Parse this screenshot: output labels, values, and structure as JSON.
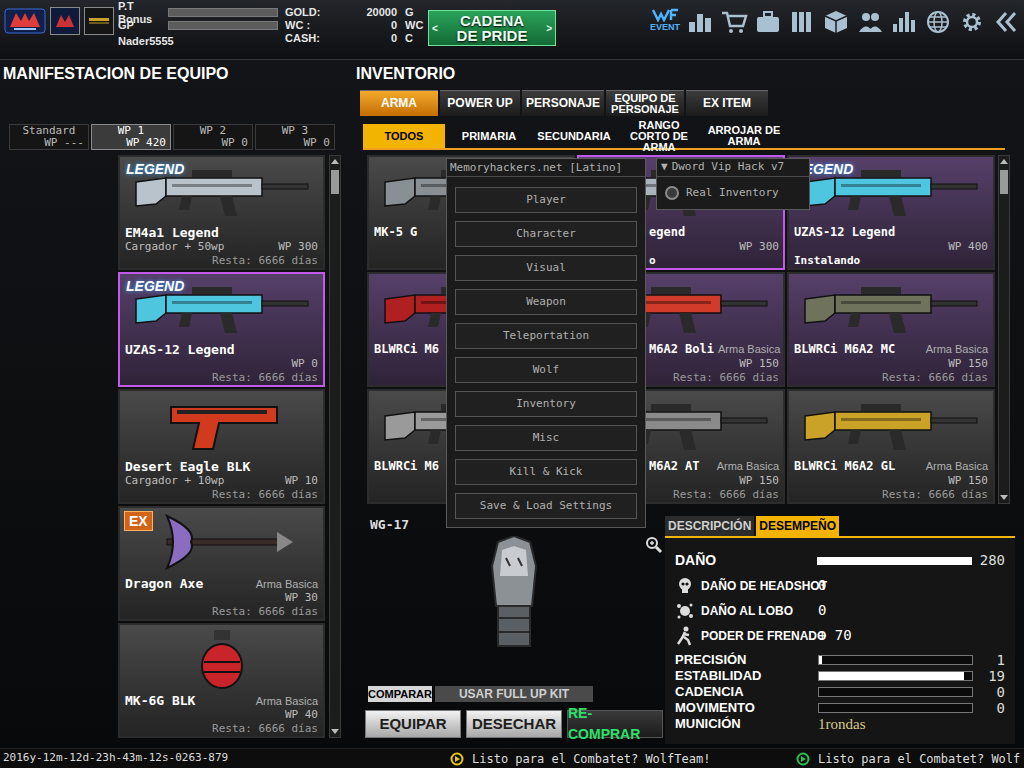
{
  "top_bar": {
    "pt_bonus": {
      "label": "P.T Bonus",
      "level": 0
    },
    "gp": {
      "label": "GP",
      "level": 0
    },
    "username": "Nader5555",
    "currencies": [
      {
        "label": "GOLD:",
        "value": "20000",
        "unit": "G"
      },
      {
        "label": "WC :",
        "value": "0",
        "unit": "WC"
      },
      {
        "label": "CASH:",
        "value": "0",
        "unit": "C"
      }
    ],
    "event_button": {
      "prev": "<",
      "line1": "CADENA",
      "line2": "DE PRIDE",
      "next": ">"
    },
    "event_label": "EVENT"
  },
  "equipment": {
    "title": "MANIFESTACION DE EQUIPO",
    "slots": [
      {
        "label": "Standard",
        "wp": "WP ---",
        "selected": false
      },
      {
        "label": "WP 1",
        "wp": "WP 420",
        "selected": true
      },
      {
        "label": "WP 2",
        "wp": "WP 0",
        "selected": false
      },
      {
        "label": "WP 3",
        "wp": "WP 0",
        "selected": false
      }
    ],
    "cards": [
      {
        "name": "EM4a1 Legend",
        "note": "Cargador + 50wp",
        "wp": "WP 300",
        "resta": "Resta: 6666 días",
        "badge": {
          "text": "LEGEND",
          "kind": "legend"
        },
        "kind": "rifle",
        "color": "#b9c3cc",
        "highlighted": false,
        "selected": false
      },
      {
        "name": "UZAS-12 Legend",
        "wp": "WP 0",
        "resta": "Resta: 6666 días",
        "badge": {
          "text": "LEGEND",
          "kind": "legend"
        },
        "kind": "rifle",
        "color": "#4fc6e0",
        "highlighted": true,
        "selected": true
      },
      {
        "name": "Desert Eagle BLK",
        "note": "Cargador + 10wp",
        "wp": "WP 10",
        "resta": "Resta: 6666 días",
        "kind": "pistol",
        "color": "#d23a1e",
        "highlighted": false,
        "selected": false
      },
      {
        "name": "Dragon Axe",
        "type": "Arma Basica",
        "wp": "WP 30",
        "resta": "Resta: 6666 días",
        "badge": {
          "text": "EX",
          "kind": "tag"
        },
        "kind": "axe",
        "color": "#8a6cc0",
        "highlighted": false,
        "selected": false
      },
      {
        "name": "MK-6G BLK",
        "type": "Arma Basica",
        "wp": "WP 40",
        "resta": "Resta: 6666 días",
        "kind": "grenade",
        "color": "#c8242a",
        "highlighted": false,
        "selected": false
      }
    ]
  },
  "inventory": {
    "title": "INVENTORIO",
    "tabs": [
      {
        "label": "ARMA",
        "selected": true
      },
      {
        "label": "POWER UP",
        "selected": false
      },
      {
        "label": "PERSONAJE",
        "selected": false
      },
      {
        "label": "EQUIPO DE PERSONAJE",
        "selected": false
      },
      {
        "label": "EX ITEM",
        "selected": false
      }
    ],
    "subtabs": [
      {
        "label": "TODOS",
        "selected": true
      },
      {
        "label": "PRIMARIA",
        "selected": false
      },
      {
        "label": "SECUNDARIA",
        "selected": false
      },
      {
        "label": "RANGO CORTO DE ARMA",
        "selected": false
      },
      {
        "label": "ARROJAR DE ARMA",
        "selected": false
      }
    ],
    "items": [
      {
        "name": "MK-5 G",
        "kind": "rifle",
        "color": "#8a8f94",
        "highlighted": false,
        "selected": false
      },
      {
        "name": "egend",
        "wp": "WP 300",
        "status": "o",
        "kind": "rifle",
        "color": "#aab4bd",
        "highlighted": true,
        "selected": true
      },
      {
        "name": "UZAS-12 Legend",
        "wp": "WP 400",
        "status": "Instalando",
        "badge": {
          "text": "LEGEND",
          "kind": "legend"
        },
        "kind": "rifle",
        "color": "#4fc6e0",
        "highlighted": true,
        "selected": false
      },
      {
        "name": "BLWRCi M6",
        "kind": "rifle",
        "color": "#b02020",
        "highlighted": true,
        "selected": false
      },
      {
        "name": "M6A2 Boli",
        "type": "Arma Basica",
        "wp": "WP 150",
        "resta": "Resta: 6666 días",
        "kind": "rifle",
        "color": "#d23a2a",
        "highlighted": true,
        "selected": false
      },
      {
        "name": "BLWRCi M6A2 MC",
        "type": "Arma Basica",
        "wp": "WP 150",
        "resta": "Resta: 6666 días",
        "kind": "rifle",
        "color": "#6f735c",
        "highlighted": true,
        "selected": false
      },
      {
        "name": "BLWRCi M6",
        "kind": "rifle",
        "color": "#9a9a9a",
        "highlighted": false,
        "selected": false
      },
      {
        "name": "M6A2 AT",
        "type": "Arma Basica",
        "wp": "WP 150",
        "resta": "Resta: 6666 días",
        "kind": "rifle",
        "color": "#8a8a8a",
        "highlighted": false,
        "selected": false
      },
      {
        "name": "BLWRCi M6A2 GL",
        "type": "Arma Basica",
        "wp": "WP 150",
        "resta": "Resta: 6666 días",
        "kind": "rifle",
        "color": "#c9a227",
        "highlighted": false,
        "selected": false
      }
    ],
    "preview": {
      "name": "WG-17"
    },
    "actions": {
      "compare": "COMPARAR",
      "full_up": "USAR FULL UP KIT",
      "equip": "EQUIPAR",
      "discard": "DESECHAR",
      "rebuy": "RE-COMPRAR"
    },
    "stats": {
      "tabs": [
        {
          "label": "DESCRIPCIÓN",
          "selected": false
        },
        {
          "label": "DESEMPEÑO",
          "selected": true
        }
      ],
      "rows": [
        {
          "label": "DAÑO",
          "kind": "bar",
          "level": 1,
          "value": "280"
        },
        {
          "label": "DAÑO DE HEADSHOT",
          "kind": "icon",
          "value": "0"
        },
        {
          "label": "DAÑO AL LOBO",
          "kind": "icon",
          "value": "0"
        },
        {
          "label": "PODER DE FRENADO",
          "kind": "icon",
          "value": "+ 70"
        },
        {
          "label": "PRECISIÓN",
          "kind": "meter",
          "level": 0.02,
          "value": "1"
        },
        {
          "label": "ESTABILIDAD",
          "kind": "meter",
          "level": 0.95,
          "value": "19"
        },
        {
          "label": "CADENCIA",
          "kind": "meter",
          "level": 0,
          "value": "0"
        },
        {
          "label": "MOVIMENTO",
          "kind": "meter",
          "level": 0,
          "value": "0"
        },
        {
          "label": "MUNICIÓN",
          "kind": "text",
          "value": "1rondas"
        }
      ]
    }
  },
  "hack_menu": {
    "title": "Memoryhackers.net [Latino]",
    "items": [
      "Player",
      "Character",
      "Visual",
      "Weapon",
      "Teleportation",
      "Wolf",
      "Inventory",
      "Misc",
      "Kill & Kick",
      "Save & Load Settings"
    ],
    "submenu": {
      "arrow": "▼",
      "title": "Dword Vip Hack v7",
      "options": [
        {
          "label": "Real Inventory",
          "checked": false
        }
      ]
    }
  },
  "status_bar": {
    "timestamp": "2016y-12m-12d-23h-43m-12s-0263-879",
    "tickers": [
      {
        "text": "Listo para el Combatet? WolfTeam!",
        "color": "#e6c619"
      },
      {
        "text": "Listo para el Combatet? Wolf",
        "color": "#2fbf4f"
      }
    ]
  }
}
